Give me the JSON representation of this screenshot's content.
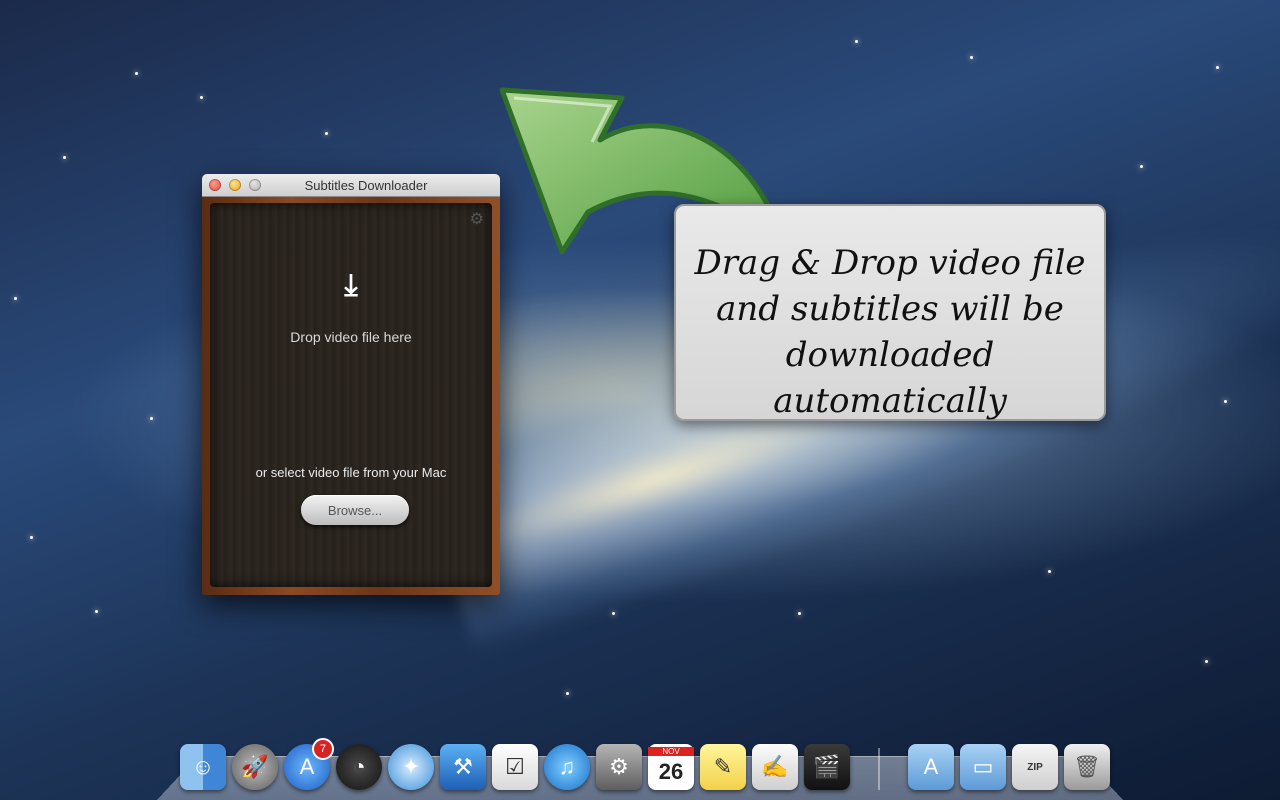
{
  "window": {
    "title": "Subtitles Downloader",
    "drop_hint": "Drop video file here",
    "select_hint": "or select video file from your Mac",
    "browse_label": "Browse..."
  },
  "callout": {
    "text": "Drag & Drop video file and subtitles will be downloaded automatically"
  },
  "dock": {
    "apps": [
      {
        "name": "Finder",
        "icon": "finder-icon"
      },
      {
        "name": "Launchpad",
        "icon": "rocket-icon"
      },
      {
        "name": "App Store",
        "icon": "app-store-icon",
        "badge": "7"
      },
      {
        "name": "Dashboard",
        "icon": "dashboard-icon"
      },
      {
        "name": "Safari",
        "icon": "compass-icon"
      },
      {
        "name": "Xcode",
        "icon": "hammer-icon"
      },
      {
        "name": "Reminders",
        "icon": "checklist-icon"
      },
      {
        "name": "iTunes",
        "icon": "music-note-icon"
      },
      {
        "name": "System Preferences",
        "icon": "gear-icon"
      },
      {
        "name": "Calendar",
        "icon": "calendar-icon",
        "month": "NOV",
        "day": "26"
      },
      {
        "name": "Stickies",
        "icon": "notes-icon"
      },
      {
        "name": "TextEdit",
        "icon": "document-icon"
      },
      {
        "name": "Final Cut",
        "icon": "clapper-icon"
      }
    ],
    "stacks": [
      {
        "name": "Applications",
        "icon": "folder-apps-icon"
      },
      {
        "name": "Documents",
        "icon": "folder-documents-icon"
      },
      {
        "name": "Archive",
        "icon": "zip-file-icon",
        "label": "ZIP"
      },
      {
        "name": "Trash",
        "icon": "trash-icon"
      }
    ]
  }
}
